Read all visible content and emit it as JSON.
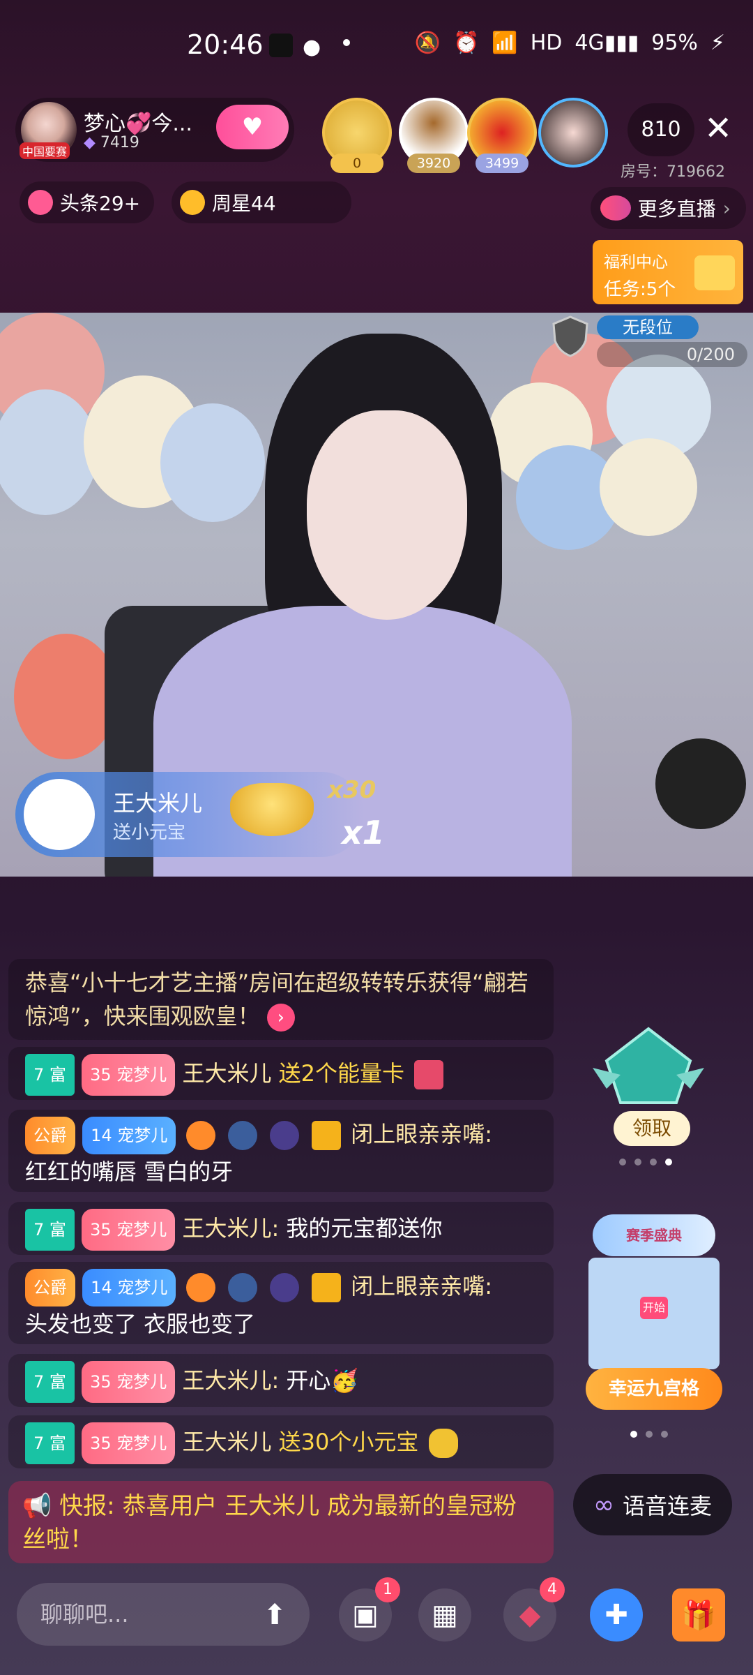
{
  "status": {
    "time": "20:46",
    "icons": [
      "tiktok-icon",
      "wechat-icon",
      "mute-icon",
      "alarm-icon",
      "wifi-icon",
      "hd",
      "4g-signal-icon",
      "battery-icon"
    ],
    "hd": "HD",
    "battery": "95%"
  },
  "host": {
    "name": "梦心💞今...",
    "fans": "7419",
    "avatar_tag": "中国要赛"
  },
  "viewers": [
    {
      "badge": "0",
      "color": "#f3c24c"
    },
    {
      "badge": "3920",
      "color": "#c9a356"
    },
    {
      "badge": "3499",
      "color": "#9aa3e2"
    }
  ],
  "audience_count": "810",
  "room_number": "房号：719662",
  "tags": {
    "headline": "头条29+",
    "weekly_star": "周星44"
  },
  "more_live": "更多直播",
  "welfare": {
    "title": "福利中心",
    "tasks": "任务:5个"
  },
  "rank": {
    "label": "无段位",
    "progress_text": "0/200",
    "progress": 0
  },
  "gift_banner": {
    "user": "王大米儿",
    "action": "送小元宝",
    "combo": "x30",
    "count": "x1"
  },
  "system_notice": {
    "text": "恭喜“小十七才艺主播”房间在超级转转乐获得“翩若惊鸿”，快来围观欧皇！"
  },
  "chat": [
    {
      "rich": "7 富",
      "pet_level": "35",
      "pet": "宠梦儿",
      "user": "王大米儿",
      "gift_text": "送2个能量卡",
      "message": ""
    },
    {
      "duke": "公爵",
      "pet_level": "14",
      "pet": "宠梦儿",
      "user": "闭上眼亲亲嘴:",
      "message": "红红的嘴唇 雪白的牙"
    },
    {
      "rich": "7 富",
      "pet_level": "35",
      "pet": "宠梦儿",
      "user": "王大米儿:",
      "message": "我的元宝都送你"
    },
    {
      "duke": "公爵",
      "pet_level": "14",
      "pet": "宠梦儿",
      "user": "闭上眼亲亲嘴:",
      "message": "头发也变了 衣服也变了"
    },
    {
      "rich": "7 富",
      "pet_level": "35",
      "pet": "宠梦儿",
      "user": "王大米儿:",
      "message": "开心🥳"
    },
    {
      "rich": "7 富",
      "pet_level": "35",
      "pet": "宠梦儿",
      "user": "王大米儿",
      "gift_text": "送30个小元宝",
      "message": ""
    }
  ],
  "announcement": {
    "prefix": "快报:",
    "text": "恭喜用户 王大米儿 成为最新的皇冠粉丝啦！"
  },
  "widgets": {
    "claim": "领取",
    "lucky_grid": "幸运九宫格",
    "lucky_start": "开始",
    "season": "赛季盛典"
  },
  "voice_link": "语音连麦",
  "bottom": {
    "placeholder": "聊聊吧...",
    "msg_badge": "1",
    "gift_badge": "4"
  }
}
